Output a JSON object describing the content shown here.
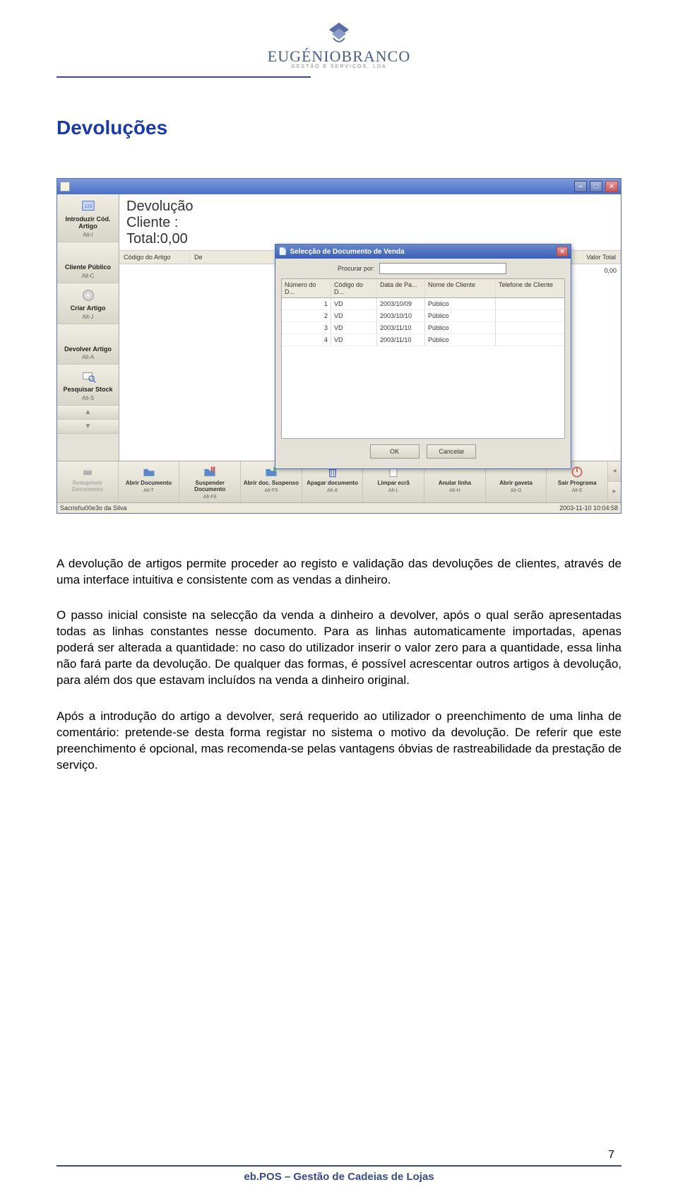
{
  "logo": {
    "name": "EUGÉNIOBRANCO",
    "tagline": "GESTÃO E SERVIÇOS, LDA"
  },
  "heading": "Devoluções",
  "app": {
    "window_controls": {
      "minimize": "–",
      "maximize": "□",
      "close": "×"
    },
    "sidebar": [
      {
        "icon": "code-icon",
        "label": "Introduzir Cód. Artigo",
        "shortcut": "Alt-I"
      },
      {
        "icon": "client-icon",
        "label": "Cliente Público",
        "shortcut": "Alt-C"
      },
      {
        "icon": "disc-icon",
        "label": "Criar Artigo",
        "shortcut": "Alt-J"
      },
      {
        "icon": "return-icon",
        "label": "Devolver Artigo",
        "shortcut": "Alt-A"
      },
      {
        "icon": "search-icon",
        "label": "Pesquisar Stock",
        "shortcut": "Alt-S"
      }
    ],
    "header": {
      "line1": "Devolução",
      "line2": "Cliente :",
      "line3": "Total:0,00"
    },
    "table_head": {
      "codigo": "Código do Artigo",
      "de": "De",
      "valor": "Valor Total"
    },
    "table_first_row_total": "0,00",
    "modal": {
      "title": "Selecção de Documento de Venda",
      "search_label": "Procurar por:",
      "columns": [
        "Número do D...",
        "Código do D...",
        "Data de Pa...",
        "Nome de Cliente",
        "Telefone de Cliente"
      ],
      "rows": [
        {
          "num": "1",
          "cod": "VD",
          "data": "2003/10/09",
          "nome": "Público",
          "tel": ""
        },
        {
          "num": "2",
          "cod": "VD",
          "data": "2003/10/10",
          "nome": "Público",
          "tel": ""
        },
        {
          "num": "3",
          "cod": "VD",
          "data": "2003/11/10",
          "nome": "Público",
          "tel": ""
        },
        {
          "num": "4",
          "cod": "VD",
          "data": "2003/11/10",
          "nome": "Público",
          "tel": ""
        }
      ],
      "ok": "OK",
      "cancel": "Cancelar"
    },
    "bottom": [
      {
        "icon": "print-icon",
        "label": "Reimprimir Documento",
        "shortcut": "",
        "disabled": true
      },
      {
        "icon": "open-icon",
        "label": "Abrir Documento",
        "shortcut": "Alt-T"
      },
      {
        "icon": "suspend-icon",
        "label": "Suspender Documento",
        "shortcut": "Alt-F8"
      },
      {
        "icon": "opensusp-icon",
        "label": "Abrir doc. Suspenso",
        "shortcut": "Alt-F9"
      },
      {
        "icon": "trash-icon",
        "label": "Apagar documento",
        "shortcut": "Alt-A"
      },
      {
        "icon": "clear-icon",
        "label": "Limpar ecrã",
        "shortcut": "Alt-L"
      },
      {
        "icon": "cancelline-icon",
        "label": "Anular linha",
        "shortcut": "Alt-H"
      },
      {
        "icon": "drawer-icon",
        "label": "Abrir gaveta",
        "shortcut": "Alt-G"
      },
      {
        "icon": "exit-icon",
        "label": "Sair Programa",
        "shortcut": "Alt-E"
      }
    ],
    "statusbar": {
      "left": "Sacrist\\u00e3o da Silva",
      "right": "2003-11-10 10:04:58"
    }
  },
  "paragraphs": [
    "A devolução de artigos permite proceder ao registo e validação das devoluções de clientes, através de uma interface intuitiva e consistente com as vendas a dinheiro.",
    "O passo inicial consiste na selecção da venda a dinheiro a devolver, após o qual serão apresentadas todas as linhas constantes nesse documento. Para as linhas automaticamente importadas, apenas poderá ser alterada a quantidade: no caso do utilizador inserir o valor zero para a quantidade, essa linha não fará parte da devolução. De qualquer das formas, é possível acrescentar outros artigos à devolução, para além dos que estavam incluídos na venda a dinheiro original.",
    "Após a introdução do artigo a devolver, será requerido ao utilizador o preenchimento de uma linha de comentário: pretende-se desta forma registar no sistema o motivo da devolução. De referir que este preenchimento é opcional, mas recomenda-se pelas vantagens óbvias de rastreabilidade da prestação de serviço."
  ],
  "page_number": "7",
  "footer": "eb.POS – Gestão de Cadeias de Lojas"
}
